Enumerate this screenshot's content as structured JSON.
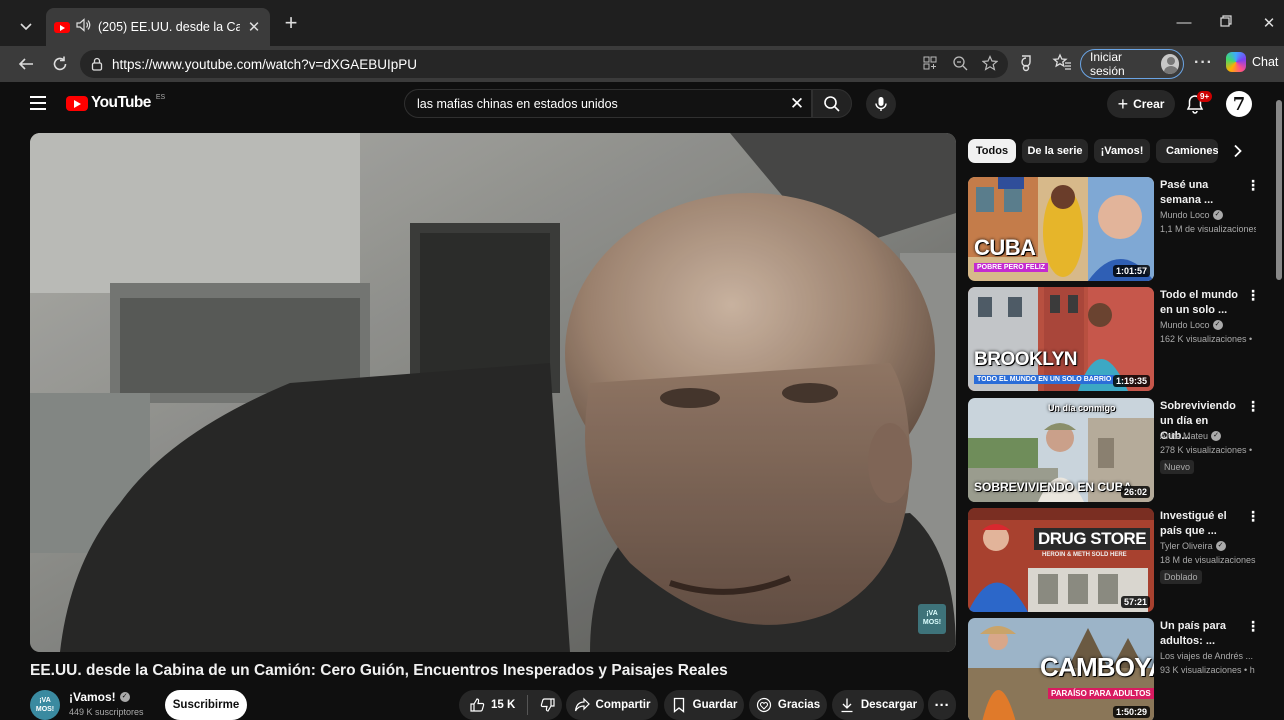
{
  "browser": {
    "tab_title": "(205) EE.UU. desde la Cabina d",
    "url": "https://www.youtube.com/watch?v=dXGAEBUIpPU",
    "signin_label": "Iniciar sesión",
    "chat_label": "Chat"
  },
  "masthead": {
    "logo_text": "YouTube",
    "country_code": "ES",
    "search_query": "las mafias chinas en estados unidos",
    "create_label": "Crear",
    "notif_count": "9+",
    "avatar_letter": "7"
  },
  "video": {
    "title": "EE.UU. desde la Cabina de un Camión: Cero Guión, Encuentros Inesperados y Paisajes Reales",
    "watermark": "¡VA MOS!",
    "channel_avatar_text": "¡VA MOS!",
    "channel_name": "¡Vamos!",
    "subscribers": "449 K suscriptores",
    "subscribe_label": "Suscribirme",
    "likes": "15 K",
    "share_label": "Compartir",
    "save_label": "Guardar",
    "thanks_label": "Gracias",
    "download_label": "Descargar"
  },
  "chips": [
    "Todos",
    "De la serie",
    "¡Vamos!",
    "Camiones"
  ],
  "recommendations": [
    {
      "title": "Pasé una semana ...",
      "channel": "Mundo Loco",
      "views": "1,1 M de visualizaciones",
      "duration": "1:01:57",
      "thumb_big": "CUBA",
      "thumb_small": "POBRE PERO FELIZ",
      "badge": ""
    },
    {
      "title": "Todo el mundo en un solo ...",
      "channel": "Mundo Loco",
      "views": "162 K visualizaciones •",
      "duration": "1:19:35",
      "thumb_big": "BROOKLYN",
      "thumb_small": "TODO EL MUNDO EN UN SOLO BARRIO",
      "badge": ""
    },
    {
      "title": "Sobreviviendo un día en Cub...",
      "channel": "Anita Mateu",
      "views": "278 K visualizaciones •",
      "duration": "26:02",
      "thumb_big": "SOBREVIVIENDO EN CUBA",
      "thumb_small": "Un día conmigo",
      "badge": "Nuevo"
    },
    {
      "title": "Investigué el país que ...",
      "channel": "Tyler Oliveira",
      "views": "18 M de visualizaciones",
      "duration": "57:21",
      "thumb_big": "DRUG STORE",
      "thumb_small": "HEROIN & METH SOLD HERE",
      "badge": "Doblado"
    },
    {
      "title": "Un país para adultos: ...",
      "channel": "Los viajes de Andrés ...",
      "views": "93 K visualizaciones • h",
      "duration": "1:50:29",
      "thumb_big": "CAMBOYA",
      "thumb_small": "PARAÍSO PARA ADULTOS",
      "badge": ""
    }
  ]
}
